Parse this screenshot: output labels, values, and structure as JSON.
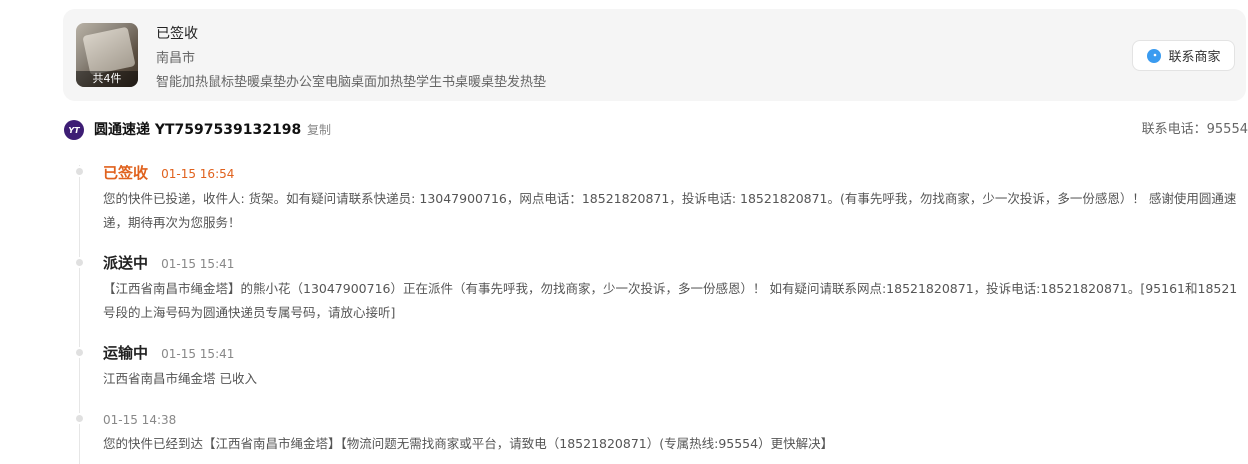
{
  "order": {
    "status": "已签收",
    "city": "南昌市",
    "title": "智能加热鼠标垫暖桌垫办公室电脑桌面加热垫学生书桌暖桌垫发热垫",
    "item_count": "共4件",
    "contact_button": "联系商家"
  },
  "carrier": {
    "logo_text": "YT",
    "name": "圆通速递 YT7597539132198",
    "copy_label": "复制",
    "phone": "联系电话：95554"
  },
  "timeline": [
    {
      "status": "已签收",
      "time": "01-15 16:54",
      "text": "您的快件已投递，收件人: 货架。如有疑问请联系快递员: 13047900716，网点电话：18521820871，投诉电话: 18521820871。(有事先呼我，勿找商家，少一次投诉，多一份感恩）！ 感谢使用圆通速递，期待再次为您服务！"
    },
    {
      "status": "派送中",
      "time": "01-15 15:41",
      "text": "【江西省南昌市绳金塔】的熊小花（13047900716）正在派件（有事先呼我，勿找商家，少一次投诉，多一份感恩）！ 如有疑问请联系网点:18521820871，投诉电话:18521820871。[95161和18521号段的上海号码为圆通快递员专属号码，请放心接听]"
    },
    {
      "status": "运输中",
      "time": "01-15 15:41",
      "text": "江西省南昌市绳金塔 已收入"
    },
    {
      "status": "",
      "time": "01-15 14:38",
      "text": "您的快件已经到达【江西省南昌市绳金塔】【物流问题无需找商家或平台，请致电（18521820871）(专属热线:95554）更快解决】"
    }
  ],
  "colors": {
    "accent": "#e0621e",
    "carrier_brand": "#3d1d74"
  }
}
